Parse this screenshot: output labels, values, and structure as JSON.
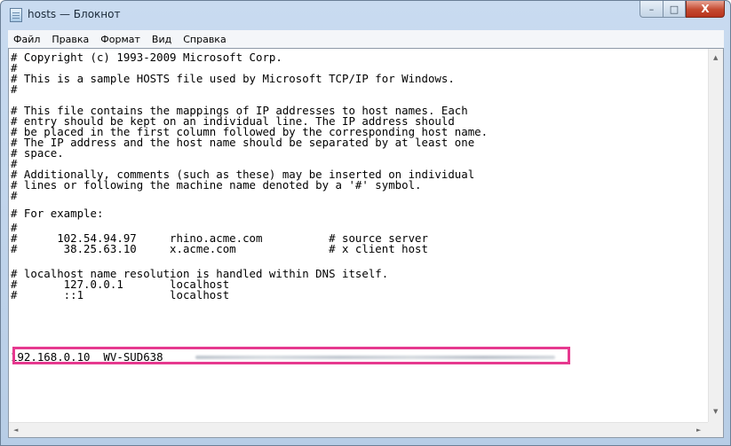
{
  "window": {
    "title": "hosts — Блокнот"
  },
  "caption": {
    "minimize": "–",
    "maximize": "□",
    "close": "X"
  },
  "menu": {
    "items": [
      "Файл",
      "Правка",
      "Формат",
      "Вид",
      "Справка"
    ]
  },
  "document": {
    "lines": [
      "# Copyright (c) 1993-2009 Microsoft Corp.",
      "#",
      "# This is a sample HOSTS file used by Microsoft TCP/IP for Windows.",
      "#",
      "# This file contains the mappings of IP addresses to host names. Each",
      "# entry should be kept on an individual line. The IP address should",
      "# be placed in the first column followed by the corresponding host name.",
      "# The IP address and the host name should be separated by at least one",
      "# space.",
      "#",
      "# Additionally, comments (such as these) may be inserted on individual",
      "# lines or following the machine name denoted by a '#' symbol.",
      "#",
      "# For example:",
      "#",
      "#      102.54.94.97     rhino.acme.com          # source server",
      "#       38.25.63.10     x.acme.com              # x client host",
      "",
      "# localhost name resolution is handled within DNS itself.",
      "#       127.0.0.1       localhost",
      "#       ::1             localhost",
      "192.168.0.10  WV-SUD638"
    ]
  },
  "scrollbars": {
    "up": "▲",
    "down": "▼",
    "left": "◄",
    "right": "►"
  },
  "colors": {
    "highlight_border": "#e6398f",
    "title_gradient_top": "#c9dbf0",
    "close_button": "#c4492f"
  }
}
